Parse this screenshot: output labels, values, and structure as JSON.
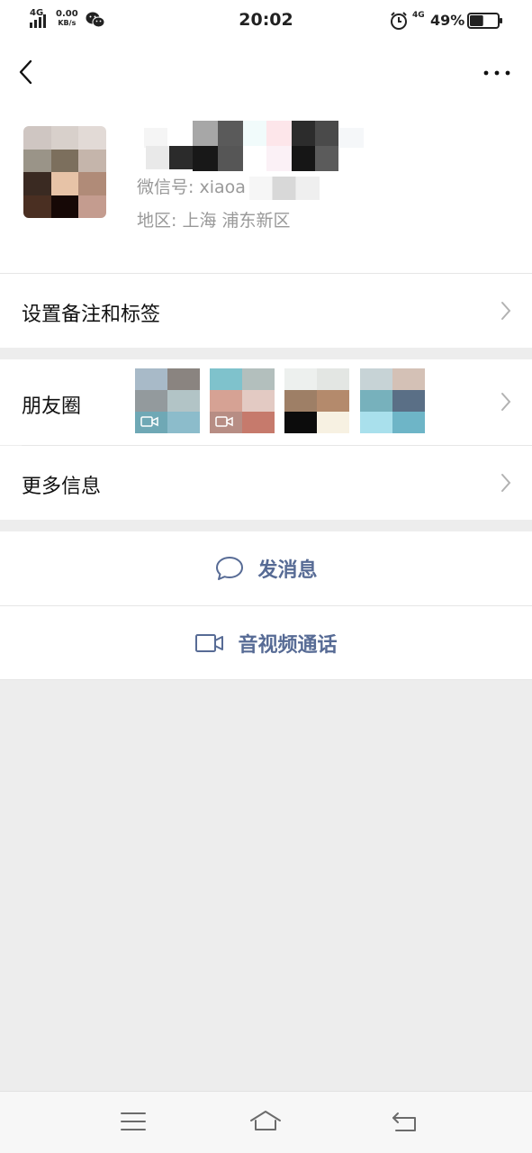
{
  "status_bar": {
    "network": "4G",
    "speed_value": "0.00",
    "speed_unit": "KB/s",
    "time": "20:02",
    "network_right": "4G",
    "battery_percent": "49%",
    "battery_level": 0.49
  },
  "profile": {
    "wechat_id_label": "微信号: ",
    "wechat_id_value": "xiaoa",
    "region_label": "地区: ",
    "region_value": "上海  浦东新区"
  },
  "rows": {
    "remark_tags": "设置备注和标签",
    "moments": "朋友圈",
    "more_info": "更多信息"
  },
  "actions": {
    "send_message": "发消息",
    "av_call": "音视频通话"
  },
  "colors": {
    "link": "#576b95",
    "page_bg": "#ededed"
  }
}
